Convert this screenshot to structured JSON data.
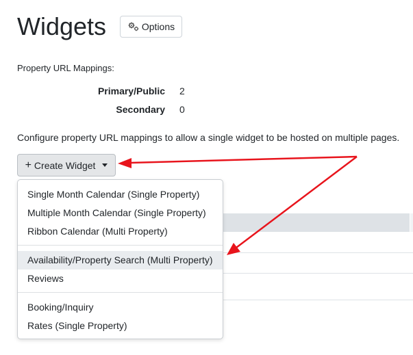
{
  "header": {
    "title": "Widgets",
    "options_label": "Options"
  },
  "mappings": {
    "heading": "Property URL Mappings:",
    "rows": [
      {
        "label": "Primary/Public",
        "value": "2"
      },
      {
        "label": "Secondary",
        "value": "0"
      }
    ],
    "description": "Configure property URL mappings to allow a single widget to be hosted on multiple pages."
  },
  "create": {
    "label": "Create Widget",
    "menu": {
      "groups": [
        [
          "Single Month Calendar (Single Property)",
          "Multiple Month Calendar (Single Property)",
          "Ribbon Calendar (Multi Property)"
        ],
        [
          "Availability/Property Search (Multi Property)",
          "Reviews"
        ],
        [
          "Booking/Inquiry",
          "Rates (Single Property)"
        ]
      ],
      "highlighted": "Availability/Property Search (Multi Property)"
    }
  },
  "annotations": {
    "arrow_color": "#e8141c"
  },
  "icons": {
    "options": "gears-icon",
    "create": "plus-icon",
    "dropdown": "caret-down-icon"
  }
}
